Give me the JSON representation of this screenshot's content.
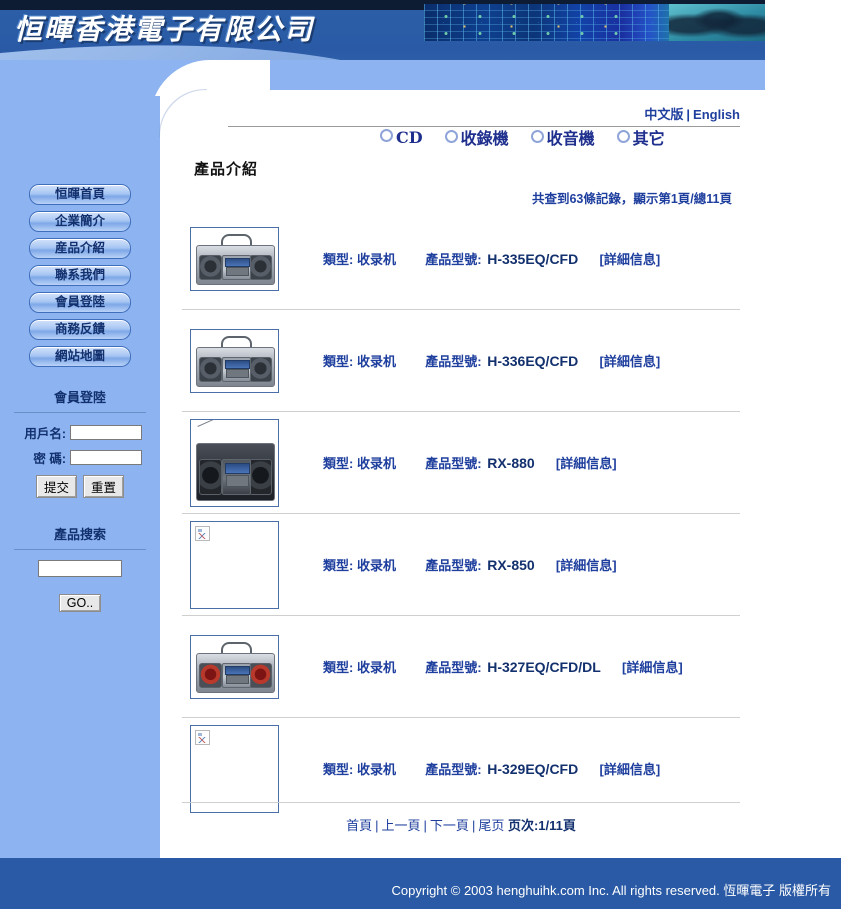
{
  "site": {
    "company_name": "恒暉香港電子有限公司"
  },
  "language_bar": {
    "chinese": "中文版",
    "separator": "|",
    "english": "English"
  },
  "categories": [
    {
      "label": "CD",
      "icon": "circle-bullet-icon"
    },
    {
      "label": "收錄機",
      "icon": "circle-bullet-icon"
    },
    {
      "label": "收音機",
      "icon": "circle-bullet-icon"
    },
    {
      "label": "其它",
      "icon": "circle-bullet-icon"
    }
  ],
  "sidebar": {
    "nav": [
      {
        "label": "恒暉首頁"
      },
      {
        "label": "企業簡介"
      },
      {
        "label": "産品介紹"
      },
      {
        "label": "聯系我們"
      },
      {
        "label": "會員登陸"
      },
      {
        "label": "商務反饋"
      },
      {
        "label": "網站地圖"
      }
    ],
    "login": {
      "title": "會員登陸",
      "username_label": "用戶名:",
      "username_value": "",
      "password_label": "密 碼:",
      "password_value": "",
      "submit_label": "提交",
      "reset_label": "重置"
    },
    "search": {
      "title": "產品搜索",
      "input_value": "",
      "go_label": "GO.."
    }
  },
  "main": {
    "page_title": "產品介紹",
    "record_info": "共查到63條記錄，顯示第1頁/總11頁",
    "type_label": "類型:",
    "model_label": "產品型號:",
    "detail_label": "[詳細信息]",
    "products": [
      {
        "type": "收录机",
        "model": "H-335EQ/CFD",
        "detail": "[詳細信息]",
        "image": "boombox-silver",
        "image_broken": false
      },
      {
        "type": "收录机",
        "model": "H-336EQ/CFD",
        "detail": "[詳細信息]",
        "image": "boombox-silver",
        "image_broken": false
      },
      {
        "type": "收录机",
        "model": "RX-880",
        "detail": "[詳細信息]",
        "image": "boombox-black-antenna",
        "image_broken": false
      },
      {
        "type": "收录机",
        "model": "RX-850",
        "detail": "[詳細信息]",
        "image": "broken-image-icon",
        "image_broken": true
      },
      {
        "type": "收录机",
        "model": "H-327EQ/CFD/DL",
        "detail": "[詳細信息]",
        "image": "boombox-red",
        "image_broken": false
      },
      {
        "type": "收录机",
        "model": "H-329EQ/CFD",
        "detail": "[詳細信息]",
        "image": "broken-image-icon",
        "image_broken": true
      }
    ],
    "pager": {
      "first": "首頁",
      "prev": "上一頁",
      "next": "下一頁",
      "last": "尾页",
      "page_info": "页次:1/11頁"
    }
  },
  "footer": {
    "copyright": "Copyright © 2003 henghuihk.com Inc. All rights reserved. 恆暉電子 版權所有"
  },
  "colors": {
    "dark_blue": "#2a5aa5",
    "light_blue": "#8db4f0",
    "link_blue": "#1f3f9e",
    "model_blue": "#12306e"
  }
}
